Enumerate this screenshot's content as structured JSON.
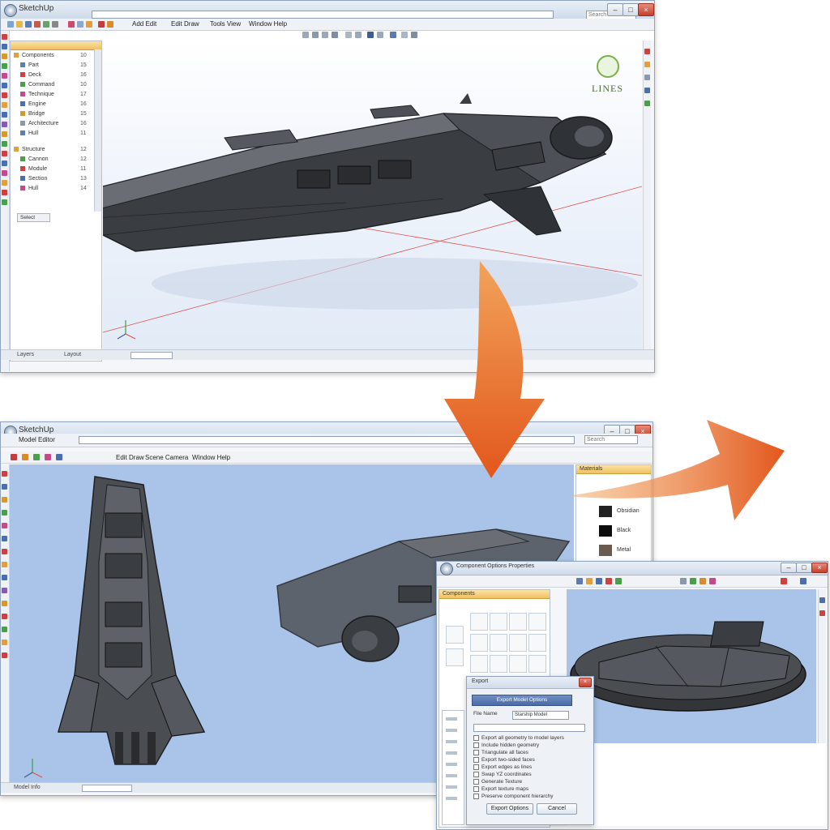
{
  "colors": {
    "accent_orange": "#e8722a",
    "viewport_blue": "#a9c4e8",
    "ship_dark": "#3a3d42",
    "axis_red": "#d9534f"
  },
  "window1": {
    "title": "SketchUp",
    "search_placeholder": "Search",
    "menu": [
      "Add Edit",
      "Edit Draw",
      "Tools View",
      "Window Help"
    ],
    "tree": [
      {
        "label": "Components",
        "value": "10"
      },
      {
        "label": "Part",
        "value": "15"
      },
      {
        "label": "Deck",
        "value": "16"
      },
      {
        "label": "Command",
        "value": "10"
      },
      {
        "label": "Technique",
        "value": "17"
      },
      {
        "label": "Engine",
        "value": "16"
      },
      {
        "label": "Bridge",
        "value": "15"
      },
      {
        "label": "Architecture",
        "value": "16"
      },
      {
        "label": "Hull",
        "value": "11"
      },
      {
        "label": "Structure",
        "value": "12"
      },
      {
        "label": "Cannon",
        "value": "12"
      },
      {
        "label": "Module",
        "value": "11"
      },
      {
        "label": "Section",
        "value": "13"
      },
      {
        "label": "Hull",
        "value": "14"
      }
    ],
    "panel_tab": "Select",
    "status_left": "Layers",
    "status_mid": "Layout",
    "logo_text": "LINES"
  },
  "window2": {
    "title": "SketchUp",
    "tab_label": "Model Editor",
    "search_placeholder": "Search",
    "menu": [
      "Edit Draw",
      "Scene Camera",
      "Window Help"
    ],
    "panel_header": "Materials",
    "swatches": [
      {
        "label": "Obsidian",
        "color": "#222222"
      },
      {
        "label": "Black",
        "color": "#0d0d0d"
      },
      {
        "label": "Metal",
        "color": "#6b5a4e"
      }
    ],
    "status_left": "Model Info"
  },
  "window3": {
    "title": "Component Options Properties",
    "panel_header": "Components"
  },
  "dialog": {
    "title": "Export",
    "header": "Export Model Options",
    "field_label": "File Name",
    "field_value": "Starship Model",
    "options": [
      "Export all geometry to model layers",
      "Include hidden geometry",
      "Triangulate all faces",
      "Export two-sided faces",
      "Export edges as lines",
      "Swap YZ coordinates",
      "Generate Texture",
      "Export texture maps",
      "Preserve component hierarchy"
    ],
    "ok_label": "Export Options",
    "cancel_label": "Cancel"
  }
}
